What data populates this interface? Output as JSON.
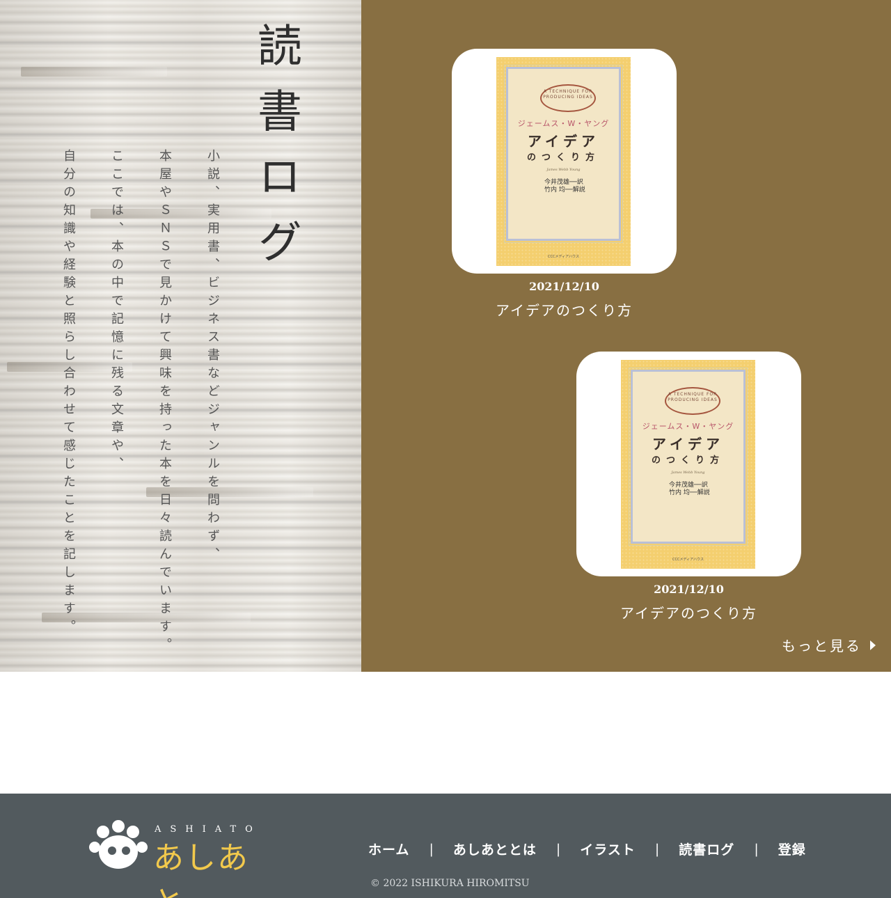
{
  "hero": {
    "title": "読書ログ",
    "paragraphs": [
      "小説、実用書、ビジネス書などジャンルを問わず、",
      "本屋やＳＮＳで見かけて興味を持った本を日々読んでいます。",
      "ここでは、本の中で記憶に残る文章や、",
      "自分の知識や経験と照らし合わせて感じたことを記します。"
    ]
  },
  "books": [
    {
      "date": "2021/12/10",
      "title": "アイデアのつくり方",
      "cover": {
        "oval_text": "A TECHNIQUE FOR PRODUCING IDEAS",
        "author": "ジェームス・W・ヤング",
        "title": "アイデア",
        "subtitle": "のつくり方",
        "english_name": "James Webb Young",
        "translator": "今井茂雄──訳",
        "commentator": "竹内 均──解説",
        "publisher": "CCCメディアハウス"
      }
    },
    {
      "date": "2021/12/10",
      "title": "アイデアのつくり方",
      "cover": {
        "oval_text": "A TECHNIQUE FOR PRODUCING IDEAS",
        "author": "ジェームス・W・ヤング",
        "title": "アイデア",
        "subtitle": "のつくり方",
        "english_name": "James Webb Young",
        "translator": "今井茂雄──訳",
        "commentator": "竹内 均──解説",
        "publisher": "CCCメディアハウス"
      }
    }
  ],
  "more_link": "もっと見る",
  "footer": {
    "logo_sub": "ASHIATO",
    "logo_main": "あしあと",
    "nav": [
      "ホーム",
      "あしあととは",
      "イラスト",
      "読書ログ",
      "登録"
    ],
    "separator": "|",
    "copyright": "© 2022 ISHIKURA HIROMITSU"
  },
  "colors": {
    "brown_panel": "#886f42",
    "footer_bg": "#525a5e",
    "logo_yellow": "#f2c94c",
    "cover_yellow": "#f4cf6f"
  }
}
